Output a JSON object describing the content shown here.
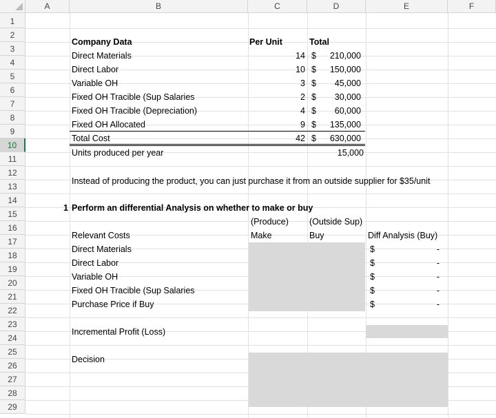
{
  "columns": [
    "A",
    "B",
    "C",
    "D",
    "E",
    "F"
  ],
  "rows": [
    "1",
    "2",
    "3",
    "4",
    "5",
    "6",
    "7",
    "8",
    "9",
    "10",
    "11",
    "12",
    "13",
    "14",
    "15",
    "16",
    "17",
    "18",
    "19",
    "20",
    "21",
    "22",
    "23",
    "24",
    "25",
    "26",
    "27",
    "28",
    "29"
  ],
  "company": {
    "header_label": "Company Data",
    "per_unit_header": "Per Unit",
    "total_header": "Total",
    "items": [
      {
        "label": "Direct Materials",
        "per_unit": "14",
        "cur": "$",
        "total": "210,000"
      },
      {
        "label": "Direct Labor",
        "per_unit": "10",
        "cur": "$",
        "total": "150,000"
      },
      {
        "label": "Variable OH",
        "per_unit": "3",
        "cur": "$",
        "total": "45,000"
      },
      {
        "label": "Fixed OH Tracible (Sup Salaries",
        "per_unit": "2",
        "cur": "$",
        "total": "30,000"
      },
      {
        "label": "Fixed OH Tracible (Depreciation)",
        "per_unit": "4",
        "cur": "$",
        "total": "60,000"
      },
      {
        "label": "Fixed OH Allocated",
        "per_unit": "9",
        "cur": "$",
        "total": "135,000"
      }
    ],
    "total_cost": {
      "label": "Total Cost",
      "per_unit": "42",
      "cur": "$",
      "total": "630,000"
    },
    "units": {
      "label": "Units produced per year",
      "value": "15,000"
    }
  },
  "note": "Instead of producing the product, you can just purchase it from an outside supplier for $35/unit",
  "question": {
    "number": "1",
    "text": "Perform an differential Analysis on whether to make or buy"
  },
  "analysis": {
    "produce_label": "(Produce)",
    "outside_label": "(Outside Sup)",
    "relevant_costs": "Relevant Costs",
    "make_label": "Make",
    "buy_label": "Buy",
    "diff_label": "Diff Analysis (Buy)",
    "items": [
      {
        "label": "Direct Materials",
        "cur": "$",
        "value": "-"
      },
      {
        "label": "Direct Labor",
        "cur": "$",
        "value": "-"
      },
      {
        "label": "Variable OH",
        "cur": "$",
        "value": "-"
      },
      {
        "label": "Fixed OH Tracible (Sup Salaries",
        "cur": "$",
        "value": "-"
      },
      {
        "label": "Purchase Price if Buy",
        "cur": "$",
        "value": "-"
      }
    ],
    "incremental": "Incremental Profit (Loss)",
    "decision": "Decision"
  }
}
